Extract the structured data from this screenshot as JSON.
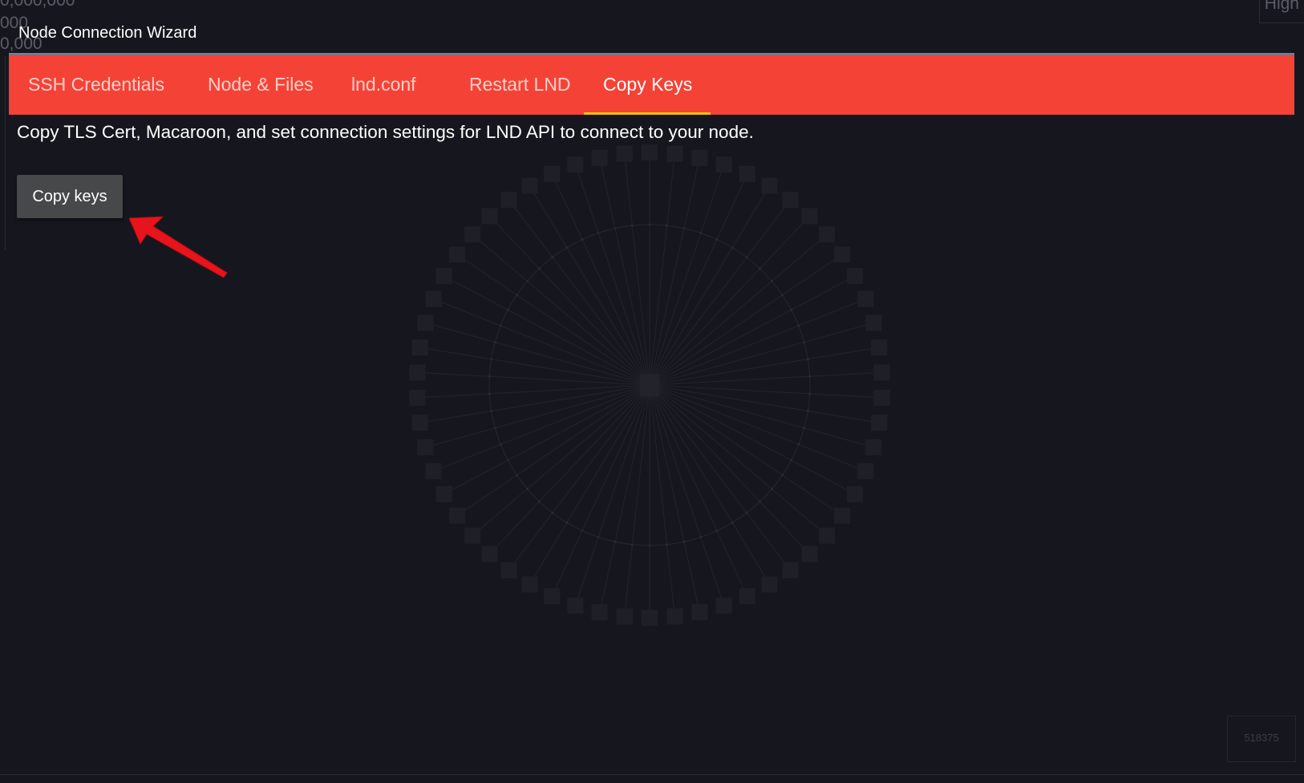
{
  "background": {
    "fragments": {
      "top_left_1": "0,000,000",
      "top_left_2": "000",
      "top_left_3": "0,000",
      "top_right": "High",
      "bottom_right": "518375"
    }
  },
  "dialog": {
    "title": "Node Connection Wizard",
    "tabs": [
      {
        "label": "SSH Credentials"
      },
      {
        "label": "Node & Files"
      },
      {
        "label": "lnd.conf"
      },
      {
        "label": "Restart LND"
      },
      {
        "label": "Copy Keys"
      }
    ],
    "description": "Copy TLS Cert, Macaroon, and set connection settings for LND API to connect to your node.",
    "copy_button_label": "Copy keys"
  },
  "colors": {
    "tab_bar": "#f44336",
    "tab_indicator": "#ffc107",
    "top_accent": "#1ba1d6",
    "button": "#474849",
    "background": "#16171e",
    "arrow": "#e8141b"
  },
  "icons": {
    "annotation": "red-arrow-icon"
  }
}
